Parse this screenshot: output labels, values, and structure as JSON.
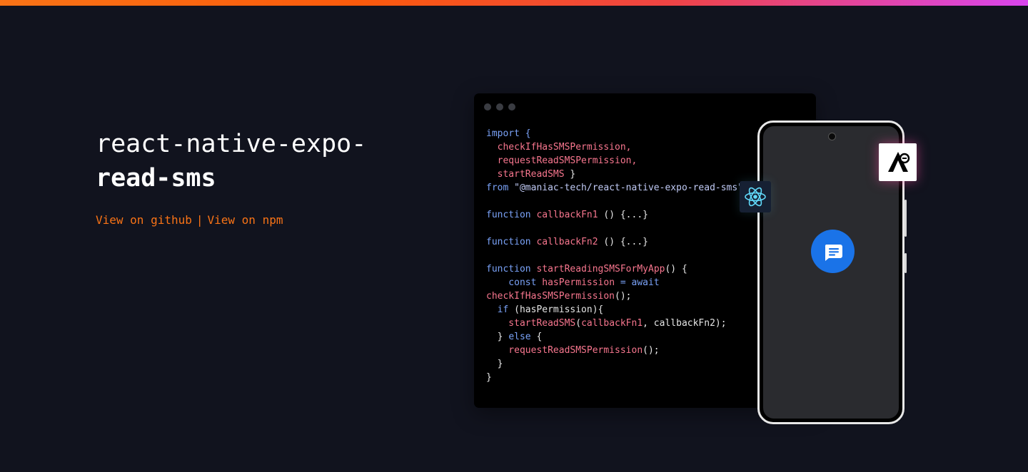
{
  "hero": {
    "title_line1": "react-native-expo-",
    "title_line2": "read-sms",
    "link_github": "View on github",
    "separator": "|",
    "link_npm": "View on npm"
  },
  "code_window": {
    "lines": [
      [
        {
          "t": "import {",
          "c": "kw"
        }
      ],
      [
        {
          "t": "  checkIfHasSMSPermission,",
          "c": "fn"
        }
      ],
      [
        {
          "t": "  requestReadSMSPermission,",
          "c": "fn"
        }
      ],
      [
        {
          "t": "  startReadSMS",
          "c": "fn"
        },
        {
          "t": " }",
          "c": "pl"
        }
      ],
      [
        {
          "t": "from ",
          "c": "kw"
        },
        {
          "t": "\"@maniac-tech/react-native-expo-read-sms\"",
          "c": "str"
        }
      ],
      [],
      [
        {
          "t": "function ",
          "c": "kw"
        },
        {
          "t": "callbackFn1",
          "c": "fn"
        },
        {
          "t": " () {...}",
          "c": "pl"
        }
      ],
      [],
      [
        {
          "t": "function ",
          "c": "kw"
        },
        {
          "t": "callbackFn2",
          "c": "fn"
        },
        {
          "t": " () {...}",
          "c": "pl"
        }
      ],
      [],
      [
        {
          "t": "function ",
          "c": "kw"
        },
        {
          "t": "startReadingSMSForMyApp",
          "c": "fn"
        },
        {
          "t": "() {",
          "c": "pl"
        }
      ],
      [
        {
          "t": "    const ",
          "c": "kw"
        },
        {
          "t": "hasPermission",
          "c": "fn"
        },
        {
          "t": " = await",
          "c": "kw"
        }
      ],
      [
        {
          "t": "checkIfHasSMSPermission",
          "c": "fn"
        },
        {
          "t": "();",
          "c": "pl"
        }
      ],
      [
        {
          "t": "  if ",
          "c": "kw"
        },
        {
          "t": "(hasPermission){",
          "c": "pl"
        }
      ],
      [
        {
          "t": "    startReadSMS",
          "c": "fn"
        },
        {
          "t": "(",
          "c": "pl"
        },
        {
          "t": "callbackFn1",
          "c": "fn"
        },
        {
          "t": ", callbackFn2);",
          "c": "pl"
        }
      ],
      [
        {
          "t": "  } ",
          "c": "pl"
        },
        {
          "t": "else",
          "c": "kw"
        },
        {
          "t": " {",
          "c": "pl"
        }
      ],
      [
        {
          "t": "    requestReadSMSPermission",
          "c": "fn"
        },
        {
          "t": "();",
          "c": "pl"
        }
      ],
      [
        {
          "t": "  }",
          "c": "pl"
        }
      ],
      [
        {
          "t": "}",
          "c": "pl"
        }
      ]
    ]
  },
  "icons": {
    "react": "react-logo-icon",
    "expo": "expo-logo-icon",
    "messages": "messages-app-icon"
  },
  "colors": {
    "background": "#11131e",
    "accent": "#f97316",
    "keyword": "#7aa2f7",
    "identifier": "#f7768e",
    "messages_blue": "#1a73e8"
  }
}
